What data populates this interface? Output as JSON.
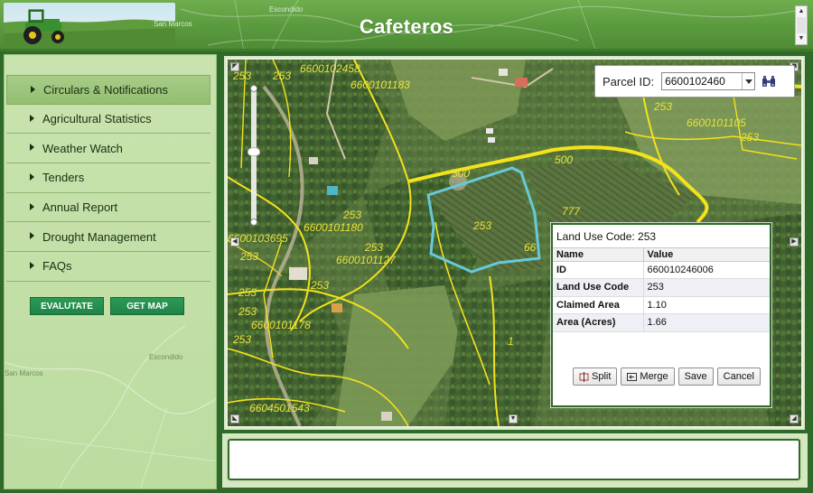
{
  "app": {
    "title": "Cafeteros"
  },
  "header": {
    "place_labels": [
      "San Marcos",
      "Escondido"
    ]
  },
  "sidebar": {
    "items": [
      {
        "label": "Circulars & Notifications",
        "active": true
      },
      {
        "label": "Agricultural Statistics",
        "active": false
      },
      {
        "label": "Weather Watch",
        "active": false
      },
      {
        "label": "Tenders",
        "active": false
      },
      {
        "label": "Annual Report",
        "active": false
      },
      {
        "label": "Drought Management",
        "active": false
      },
      {
        "label": "FAQs",
        "active": false
      }
    ],
    "buttons": {
      "evaluate": "EVALUTATE",
      "get_map": "GET MAP"
    },
    "place_labels": [
      "San Marcos",
      "Escondido"
    ]
  },
  "map": {
    "parcel_search": {
      "label": "Parcel ID:",
      "value": "6600102460"
    },
    "labels": {
      "l1": "253",
      "l2": "6600102458",
      "l3": "6600101183",
      "l4": "253",
      "l5": "253",
      "l6": "6600101105",
      "l7": "253",
      "l8": "500",
      "l9": "500",
      "l10": "253",
      "l11": "253",
      "l12": "6600101180",
      "l13": "6600103695",
      "l14": "253",
      "l15": "6600101127",
      "l16": "253",
      "l17": "253",
      "l18": "253",
      "l19": "6600101178",
      "l20": "253",
      "l21": "253",
      "l22": "6604501543",
      "l23": "777",
      "l24": "1",
      "l25": "66"
    },
    "colors": {
      "boundary": "#f3e21c",
      "selected_parcel": "#67c9d9",
      "label": "#e8e23a"
    }
  },
  "popup": {
    "title": "Land Use Code: 253",
    "columns": [
      "Name",
      "Value"
    ],
    "rows": [
      {
        "name": "ID",
        "value": "660010246006"
      },
      {
        "name": "Land Use Code",
        "value": "253"
      },
      {
        "name": "Claimed Area",
        "value": "1.10"
      },
      {
        "name": "Area (Acres)",
        "value": "1.66"
      }
    ],
    "buttons": {
      "split": "Split",
      "merge": "Merge",
      "save": "Save",
      "cancel": "Cancel"
    }
  },
  "bottom_panel": {
    "text": ""
  }
}
